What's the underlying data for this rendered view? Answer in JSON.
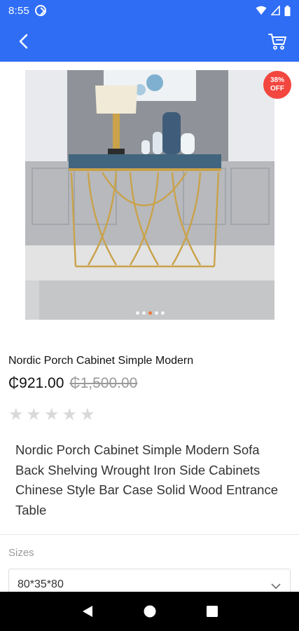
{
  "status_bar": {
    "time": "8:55",
    "icons": [
      "sync-icon",
      "wifi-icon",
      "signal-icon",
      "battery-icon"
    ]
  },
  "app_bar": {
    "background": "#2f6df5",
    "back_icon": "back-arrow-icon",
    "cart_icon": "cart-icon"
  },
  "product": {
    "image_icon": "product-photo-console-table",
    "discount_badge": "38%\nOFF",
    "carousel": {
      "count": 5,
      "active_index": 2
    },
    "title": "Nordic Porch Cabinet Simple Modern",
    "price": "₵921.00",
    "old_price": "₵1,500.00",
    "rating": {
      "value": 0,
      "max": 5,
      "star_color": "#d9d9d9"
    },
    "description": "Nordic Porch Cabinet Simple Modern Sofa Back Shelving Wrought Iron Side Cabinets Chinese Style Bar Case Solid Wood Entrance Table"
  },
  "options": {
    "sizes_label": "Sizes",
    "selected_size": "80*35*80"
  },
  "colors": {
    "accent": "#2f6df5",
    "badge": "#f2463f",
    "active_dot": "#f07a35"
  }
}
